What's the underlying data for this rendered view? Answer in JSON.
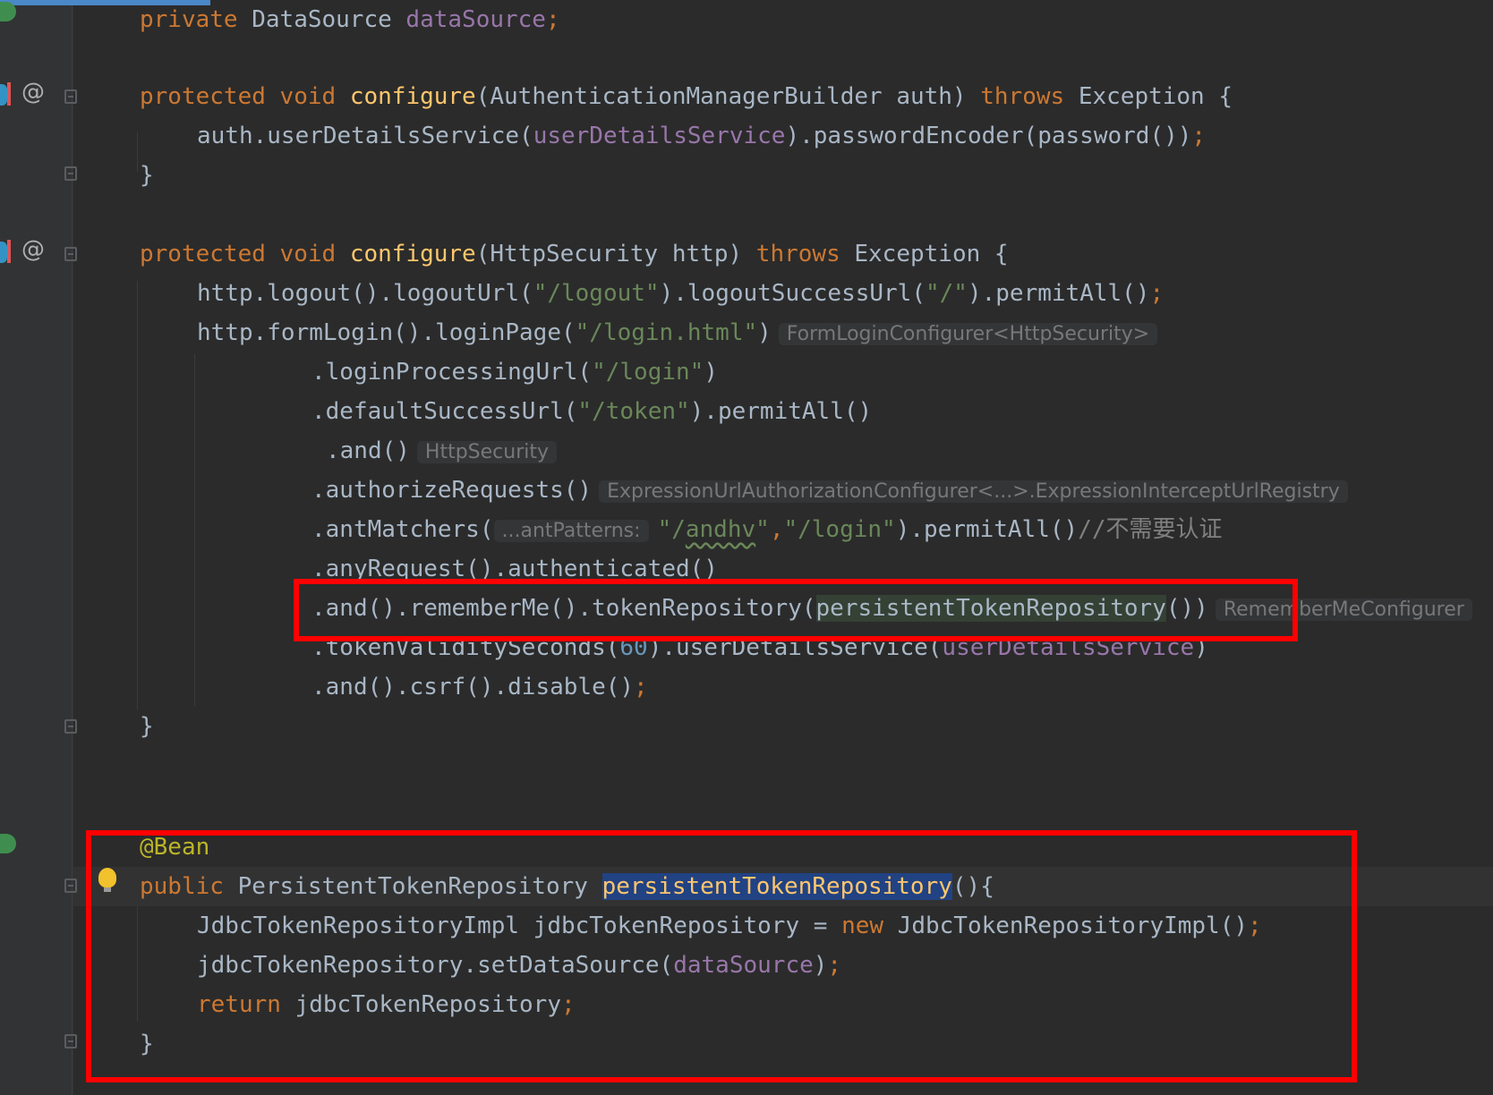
{
  "editor": {
    "lines": {
      "l1": [
        "private",
        " DataSource ",
        "dataSource",
        ";"
      ],
      "l2": [
        "protected",
        " ",
        "void",
        " ",
        "configure",
        "(AuthenticationManagerBuilder auth) ",
        "throws",
        " Exception {"
      ],
      "l3": [
        "auth.userDetailsService(",
        "userDetailsService",
        ").passwordEncoder(password())",
        ";"
      ],
      "l4": "}",
      "l5": [
        "protected",
        " ",
        "void",
        " ",
        "configure",
        "(HttpSecurity http) ",
        "throws",
        " Exception {"
      ],
      "l6": [
        "http.logout().logoutUrl(",
        "\"/logout\"",
        ").logoutSuccessUrl(",
        "\"/\"",
        ").permitAll()",
        ";"
      ],
      "l7": [
        "http.formLogin().loginPage(",
        "\"/login.html\"",
        ")"
      ],
      "l8": [
        ".loginProcessingUrl(",
        "\"/login\"",
        ")"
      ],
      "l9": [
        ".defaultSuccessUrl(",
        "\"/token\"",
        ").permitAll()"
      ],
      "l10": ".and()",
      "l11": ".authorizeRequests()",
      "l12": [
        ".antMatchers(",
        "\"/",
        "andhv",
        "\"",
        ",",
        "\"/login\"",
        ").permitAll()",
        "//不需要认证"
      ],
      "l13": ".anyRequest().authenticated()",
      "l14": [
        ".and().rememberMe().tokenRepository(",
        "persistentTokenRepository",
        "())"
      ],
      "l15": [
        ".tokenValiditySeconds(",
        "60",
        ").userDetailsService(",
        "userDetailsService",
        ")"
      ],
      "l16": [
        ".and().csrf().disable()",
        ";"
      ],
      "l17": "}",
      "l18": "@Bean",
      "l19": [
        "public",
        " PersistentTokenRepository ",
        "persistentTokenRepository",
        "(){"
      ],
      "l20": [
        "JdbcTokenRepositoryImpl jdbcTokenRepository = ",
        "new",
        " JdbcTokenRepositoryImpl()",
        ";"
      ],
      "l21": [
        "jdbcTokenRepository.setDataSource(",
        "dataSource",
        ")",
        ";"
      ],
      "l22": [
        "return",
        " jdbcTokenRepository",
        ";"
      ],
      "l23": "}"
    },
    "hints": {
      "formLogin": "FormLoginConfigurer<HttpSecurity>",
      "and": "HttpSecurity",
      "authorize": "ExpressionUrlAuthorizationConfigurer<...>.ExpressionInterceptUrlRegistry",
      "antPatterns": "...antPatterns:",
      "rememberMe": "RememberMeConfigurer"
    },
    "gutter": {
      "at_symbol": "@"
    }
  },
  "colors": {
    "background": "#2b2b2b",
    "keyword": "#cc7832",
    "method_decl": "#ffc66d",
    "field": "#9876aa",
    "string": "#6a8759",
    "number": "#6897bb",
    "annotation": "#bbb529",
    "highlight_box": "#ff0000"
  }
}
